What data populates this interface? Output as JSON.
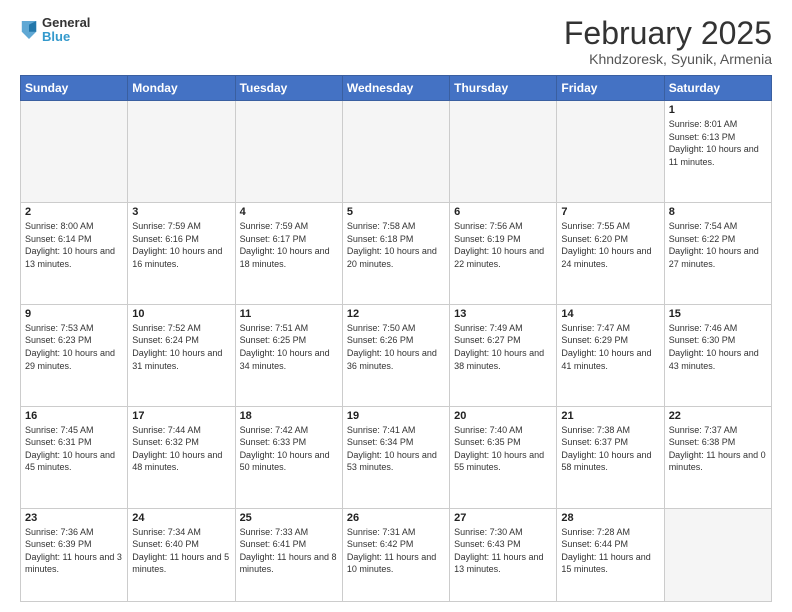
{
  "logo": {
    "general": "General",
    "blue": "Blue"
  },
  "title": "February 2025",
  "location": "Khndzoresk, Syunik, Armenia",
  "days_header": [
    "Sunday",
    "Monday",
    "Tuesday",
    "Wednesday",
    "Thursday",
    "Friday",
    "Saturday"
  ],
  "weeks": [
    [
      {
        "day": "",
        "info": ""
      },
      {
        "day": "",
        "info": ""
      },
      {
        "day": "",
        "info": ""
      },
      {
        "day": "",
        "info": ""
      },
      {
        "day": "",
        "info": ""
      },
      {
        "day": "",
        "info": ""
      },
      {
        "day": "1",
        "info": "Sunrise: 8:01 AM\nSunset: 6:13 PM\nDaylight: 10 hours\nand 11 minutes."
      }
    ],
    [
      {
        "day": "2",
        "info": "Sunrise: 8:00 AM\nSunset: 6:14 PM\nDaylight: 10 hours\nand 13 minutes."
      },
      {
        "day": "3",
        "info": "Sunrise: 7:59 AM\nSunset: 6:16 PM\nDaylight: 10 hours\nand 16 minutes."
      },
      {
        "day": "4",
        "info": "Sunrise: 7:59 AM\nSunset: 6:17 PM\nDaylight: 10 hours\nand 18 minutes."
      },
      {
        "day": "5",
        "info": "Sunrise: 7:58 AM\nSunset: 6:18 PM\nDaylight: 10 hours\nand 20 minutes."
      },
      {
        "day": "6",
        "info": "Sunrise: 7:56 AM\nSunset: 6:19 PM\nDaylight: 10 hours\nand 22 minutes."
      },
      {
        "day": "7",
        "info": "Sunrise: 7:55 AM\nSunset: 6:20 PM\nDaylight: 10 hours\nand 24 minutes."
      },
      {
        "day": "8",
        "info": "Sunrise: 7:54 AM\nSunset: 6:22 PM\nDaylight: 10 hours\nand 27 minutes."
      }
    ],
    [
      {
        "day": "9",
        "info": "Sunrise: 7:53 AM\nSunset: 6:23 PM\nDaylight: 10 hours\nand 29 minutes."
      },
      {
        "day": "10",
        "info": "Sunrise: 7:52 AM\nSunset: 6:24 PM\nDaylight: 10 hours\nand 31 minutes."
      },
      {
        "day": "11",
        "info": "Sunrise: 7:51 AM\nSunset: 6:25 PM\nDaylight: 10 hours\nand 34 minutes."
      },
      {
        "day": "12",
        "info": "Sunrise: 7:50 AM\nSunset: 6:26 PM\nDaylight: 10 hours\nand 36 minutes."
      },
      {
        "day": "13",
        "info": "Sunrise: 7:49 AM\nSunset: 6:27 PM\nDaylight: 10 hours\nand 38 minutes."
      },
      {
        "day": "14",
        "info": "Sunrise: 7:47 AM\nSunset: 6:29 PM\nDaylight: 10 hours\nand 41 minutes."
      },
      {
        "day": "15",
        "info": "Sunrise: 7:46 AM\nSunset: 6:30 PM\nDaylight: 10 hours\nand 43 minutes."
      }
    ],
    [
      {
        "day": "16",
        "info": "Sunrise: 7:45 AM\nSunset: 6:31 PM\nDaylight: 10 hours\nand 45 minutes."
      },
      {
        "day": "17",
        "info": "Sunrise: 7:44 AM\nSunset: 6:32 PM\nDaylight: 10 hours\nand 48 minutes."
      },
      {
        "day": "18",
        "info": "Sunrise: 7:42 AM\nSunset: 6:33 PM\nDaylight: 10 hours\nand 50 minutes."
      },
      {
        "day": "19",
        "info": "Sunrise: 7:41 AM\nSunset: 6:34 PM\nDaylight: 10 hours\nand 53 minutes."
      },
      {
        "day": "20",
        "info": "Sunrise: 7:40 AM\nSunset: 6:35 PM\nDaylight: 10 hours\nand 55 minutes."
      },
      {
        "day": "21",
        "info": "Sunrise: 7:38 AM\nSunset: 6:37 PM\nDaylight: 10 hours\nand 58 minutes."
      },
      {
        "day": "22",
        "info": "Sunrise: 7:37 AM\nSunset: 6:38 PM\nDaylight: 11 hours\nand 0 minutes."
      }
    ],
    [
      {
        "day": "23",
        "info": "Sunrise: 7:36 AM\nSunset: 6:39 PM\nDaylight: 11 hours\nand 3 minutes."
      },
      {
        "day": "24",
        "info": "Sunrise: 7:34 AM\nSunset: 6:40 PM\nDaylight: 11 hours\nand 5 minutes."
      },
      {
        "day": "25",
        "info": "Sunrise: 7:33 AM\nSunset: 6:41 PM\nDaylight: 11 hours\nand 8 minutes."
      },
      {
        "day": "26",
        "info": "Sunrise: 7:31 AM\nSunset: 6:42 PM\nDaylight: 11 hours\nand 10 minutes."
      },
      {
        "day": "27",
        "info": "Sunrise: 7:30 AM\nSunset: 6:43 PM\nDaylight: 11 hours\nand 13 minutes."
      },
      {
        "day": "28",
        "info": "Sunrise: 7:28 AM\nSunset: 6:44 PM\nDaylight: 11 hours\nand 15 minutes."
      },
      {
        "day": "",
        "info": ""
      }
    ]
  ]
}
